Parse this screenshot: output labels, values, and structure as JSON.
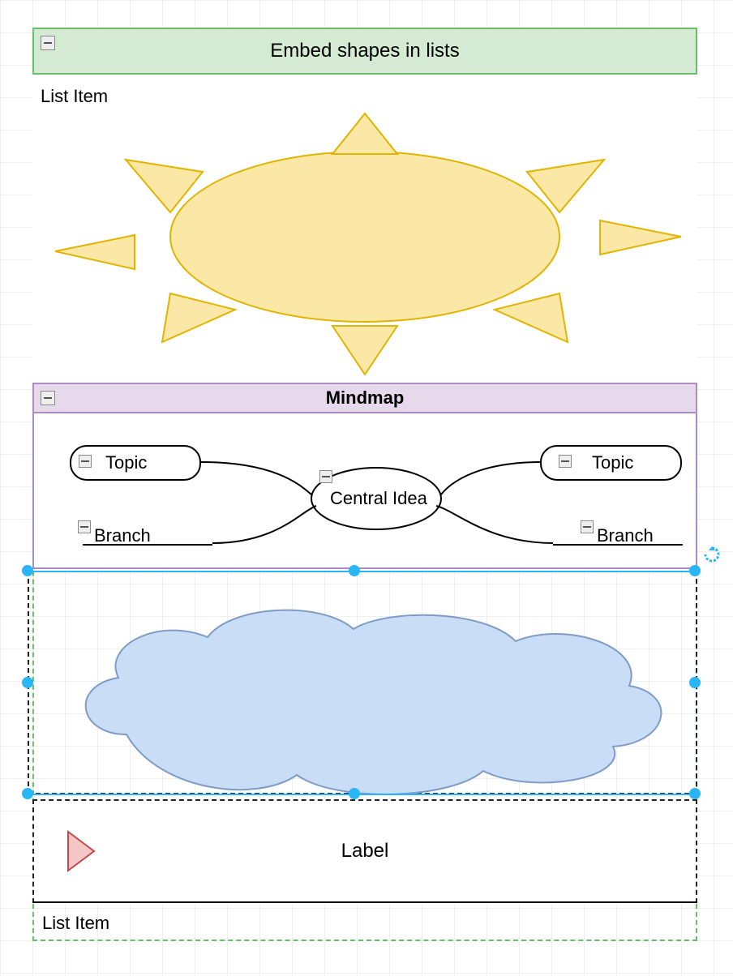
{
  "list": {
    "title": "Embed shapes in lists",
    "item1_label": "List Item",
    "item2_label": "List Item"
  },
  "mindmap": {
    "title": "Mindmap",
    "central": "Central Idea",
    "topic_left": "Topic",
    "topic_right": "Topic",
    "branch_left": "Branch",
    "branch_right": "Branch"
  },
  "label_row": {
    "text": "Label"
  },
  "colors": {
    "sun_fill": "#fbe8a6",
    "sun_stroke": "#e0b400",
    "cloud_fill": "#c9ddf7",
    "cloud_stroke": "#7f9cc6",
    "play_fill": "#f5c6c6",
    "play_stroke": "#c04a4a",
    "selection": "#29b6f6"
  }
}
